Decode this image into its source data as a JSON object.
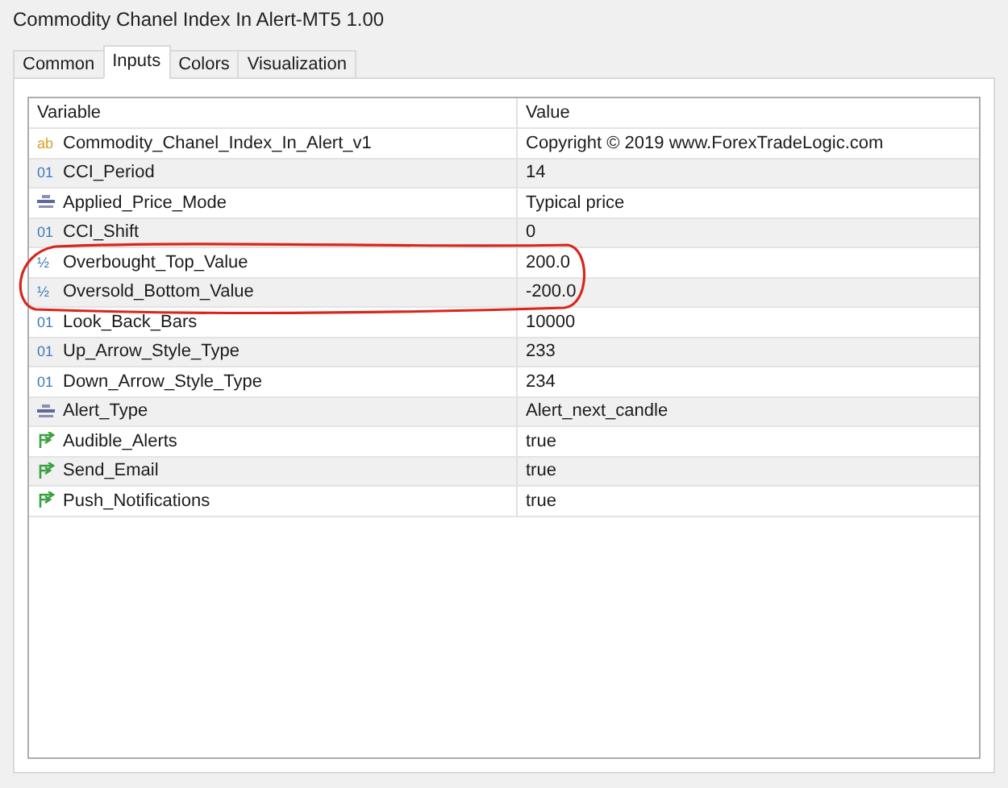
{
  "window": {
    "title": "Commodity Chanel Index In Alert-MT5 1.00"
  },
  "tabs": [
    {
      "label": "Common",
      "selected": false
    },
    {
      "label": "Inputs",
      "selected": true
    },
    {
      "label": "Colors",
      "selected": false
    },
    {
      "label": "Visualization",
      "selected": false
    }
  ],
  "table": {
    "columns": [
      "Variable",
      "Value"
    ],
    "rows": [
      {
        "kind": "string",
        "icon_text": "ab",
        "variable": "Commodity_Chanel_Index_In_Alert_v1",
        "value": "Copyright © 2019 www.ForexTradeLogic.com",
        "circled": false
      },
      {
        "kind": "int",
        "icon_text": "01",
        "variable": "CCI_Period",
        "value": "14",
        "circled": false
      },
      {
        "kind": "enum",
        "variable": "Applied_Price_Mode",
        "value": "Typical price",
        "circled": false
      },
      {
        "kind": "int",
        "icon_text": "01",
        "variable": "CCI_Shift",
        "value": "0",
        "circled": false
      },
      {
        "kind": "double",
        "icon_text": "½",
        "variable": "Overbought_Top_Value",
        "value": "200.0",
        "circled": true
      },
      {
        "kind": "double",
        "icon_text": "½",
        "variable": "Oversold_Bottom_Value",
        "value": "-200.0",
        "circled": true
      },
      {
        "kind": "int",
        "icon_text": "01",
        "variable": "Look_Back_Bars",
        "value": "10000",
        "circled": false
      },
      {
        "kind": "int",
        "icon_text": "01",
        "variable": "Up_Arrow_Style_Type",
        "value": "233",
        "circled": false
      },
      {
        "kind": "int",
        "icon_text": "01",
        "variable": "Down_Arrow_Style_Type",
        "value": "234",
        "circled": false
      },
      {
        "kind": "enum",
        "variable": "Alert_Type",
        "value": "Alert_next_candle",
        "circled": false
      },
      {
        "kind": "bool",
        "variable": "Audible_Alerts",
        "value": "true",
        "circled": false
      },
      {
        "kind": "bool",
        "variable": "Send_Email",
        "value": "true",
        "circled": false
      },
      {
        "kind": "bool",
        "variable": "Push_Notifications",
        "value": "true",
        "circled": false
      }
    ]
  }
}
